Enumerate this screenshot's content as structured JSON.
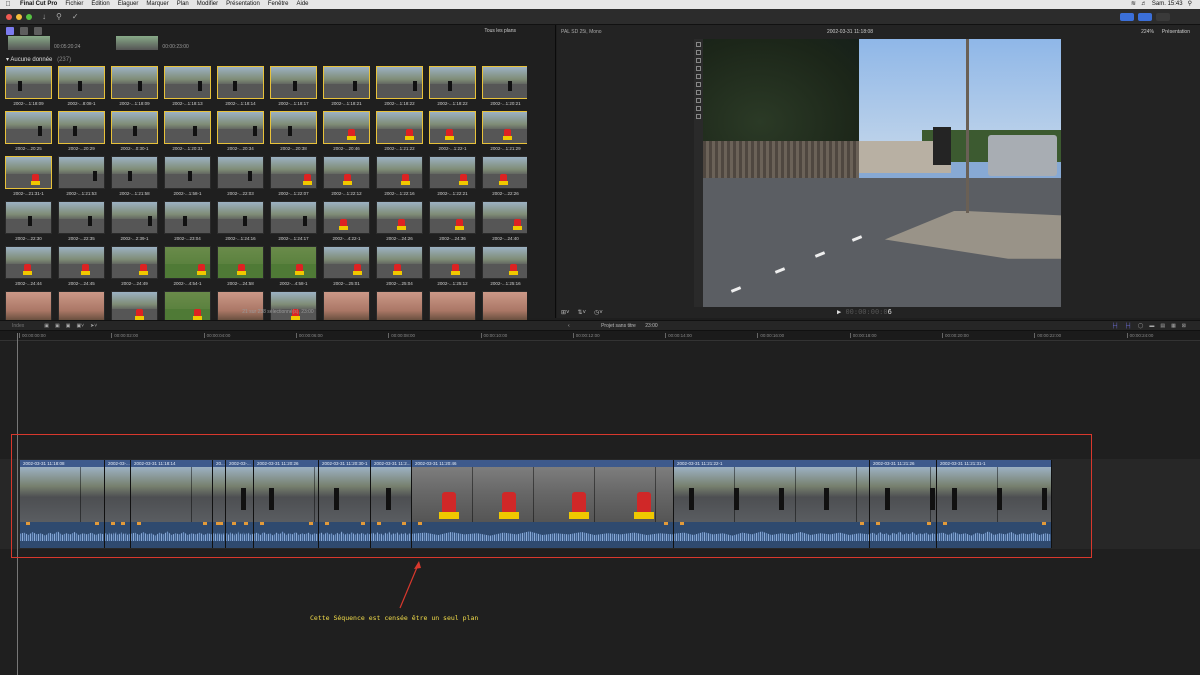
{
  "menubar": {
    "app": "Final Cut Pro",
    "items": [
      "Fichier",
      "Édition",
      "Élaguer",
      "Marquer",
      "Plan",
      "Modifier",
      "Présentation",
      "Fenêtre",
      "Aide"
    ],
    "clock": "Sam. 15:43"
  },
  "browser": {
    "filter": "Tous les plans",
    "top_clips": [
      {
        "time": "00:05:20:24"
      },
      {
        "time": "00:00:23:00"
      }
    ],
    "section": "Aucune donnée",
    "section_count": "(237)",
    "thumbs": [
      {
        "label": "2002-...1:18:09",
        "sel": true,
        "scene": "road"
      },
      {
        "label": "2002-...8:08-1",
        "sel": true,
        "scene": "road"
      },
      {
        "label": "2002-...1:18:09",
        "sel": true,
        "scene": "road"
      },
      {
        "label": "2002-...1:18:13",
        "sel": true,
        "scene": "road"
      },
      {
        "label": "2002-...1:18:14",
        "sel": true,
        "scene": "road"
      },
      {
        "label": "2002-...1:18:17",
        "sel": true,
        "scene": "road"
      },
      {
        "label": "2002-...1:18:21",
        "sel": true,
        "scene": "road"
      },
      {
        "label": "2002-...1:18:22",
        "sel": true,
        "scene": "road"
      },
      {
        "label": "2002-...1:18:22",
        "sel": true,
        "scene": "road"
      },
      {
        "label": "2002-...1:20:21",
        "sel": true,
        "scene": "road"
      },
      {
        "label": "2002-...20:25",
        "sel": true,
        "scene": "walk"
      },
      {
        "label": "2002-...20:29",
        "sel": true,
        "scene": "walk"
      },
      {
        "label": "2002-...0:30-1",
        "sel": true,
        "scene": "walk"
      },
      {
        "label": "2002-...1:20:31",
        "sel": true,
        "scene": "walk"
      },
      {
        "label": "2002-...20:34",
        "sel": true,
        "scene": "walk"
      },
      {
        "label": "2002-...20:38",
        "sel": true,
        "scene": "walk"
      },
      {
        "label": "2002-...20:46",
        "sel": true,
        "scene": "kid"
      },
      {
        "label": "2002-...1:21:22",
        "sel": true,
        "scene": "kid"
      },
      {
        "label": "2002-...1:22-1",
        "sel": true,
        "scene": "kid"
      },
      {
        "label": "2002-...1:21:29",
        "sel": true,
        "scene": "kid"
      },
      {
        "label": "2002-...21:31-1",
        "sel": true,
        "scene": "kid"
      },
      {
        "label": "2002-...1:21:53",
        "sel": false,
        "scene": "walk"
      },
      {
        "label": "2002-...1:21:58",
        "sel": false,
        "scene": "walk"
      },
      {
        "label": "2002-...1:58-1",
        "sel": false,
        "scene": "walk"
      },
      {
        "label": "2002-...22:03",
        "sel": false,
        "scene": "walk"
      },
      {
        "label": "2002-...1:22:07",
        "sel": false,
        "scene": "kid"
      },
      {
        "label": "2002-...1:22:12",
        "sel": false,
        "scene": "kid"
      },
      {
        "label": "2002-...1:22:16",
        "sel": false,
        "scene": "kid"
      },
      {
        "label": "2002-...1:22:21",
        "sel": false,
        "scene": "kid"
      },
      {
        "label": "2002-...22:26",
        "sel": false,
        "scene": "kid"
      },
      {
        "label": "2002-...22:30",
        "sel": false,
        "scene": "walk"
      },
      {
        "label": "2002-...22:35",
        "sel": false,
        "scene": "walk"
      },
      {
        "label": "2002-...2:39-1",
        "sel": false,
        "scene": "walk"
      },
      {
        "label": "2002-...23:04",
        "sel": false,
        "scene": "walk"
      },
      {
        "label": "2002-...1:24:16",
        "sel": false,
        "scene": "walk"
      },
      {
        "label": "2002-...1:24:17",
        "sel": false,
        "scene": "walk"
      },
      {
        "label": "2002-...4:22-1",
        "sel": false,
        "scene": "kid"
      },
      {
        "label": "2002-...24:26",
        "sel": false,
        "scene": "kid"
      },
      {
        "label": "2002-...24:36",
        "sel": false,
        "scene": "kid"
      },
      {
        "label": "2002-...24:40",
        "sel": false,
        "scene": "kid"
      },
      {
        "label": "2002-...24:44",
        "sel": false,
        "scene": "kid"
      },
      {
        "label": "2002-...24:45",
        "sel": false,
        "scene": "kid"
      },
      {
        "label": "2002-...24:49",
        "sel": false,
        "scene": "kid"
      },
      {
        "label": "2002-...4:54-1",
        "sel": false,
        "scene": "grass"
      },
      {
        "label": "2002-...24:58",
        "sel": false,
        "scene": "grass"
      },
      {
        "label": "2002-...4:58-1",
        "sel": false,
        "scene": "grass"
      },
      {
        "label": "2002-...25:01",
        "sel": false,
        "scene": "kid"
      },
      {
        "label": "2002-...25:04",
        "sel": false,
        "scene": "kid"
      },
      {
        "label": "2002-...1:25:12",
        "sel": false,
        "scene": "kid"
      },
      {
        "label": "2002-...1:25:16",
        "sel": false,
        "scene": "kid"
      },
      {
        "label": "",
        "sel": false,
        "scene": "close"
      },
      {
        "label": "",
        "sel": false,
        "scene": "close"
      },
      {
        "label": "",
        "sel": false,
        "scene": "kid"
      },
      {
        "label": "",
        "sel": false,
        "scene": "grass"
      },
      {
        "label": "",
        "sel": false,
        "scene": "close"
      },
      {
        "label": "",
        "sel": false,
        "scene": "kid"
      },
      {
        "label": "",
        "sel": false,
        "scene": "close"
      },
      {
        "label": "",
        "sel": false,
        "scene": "close"
      },
      {
        "label": "",
        "sel": false,
        "scene": "close"
      },
      {
        "label": "",
        "sel": false,
        "scene": "close"
      }
    ],
    "status": "21 sur 238 sélectionné(s), 23:00"
  },
  "viewer": {
    "format": "PAL SD 25i, Mono",
    "title": "2002-03-31 11:18:08",
    "zoom": "224%",
    "presentation": "Présentation",
    "timecode_dim": "00:00:00:0",
    "timecode_val": "6"
  },
  "timeline": {
    "index": "Index",
    "project": "Projet sans titre",
    "duration": "23:00",
    "ruler": [
      "00:00:00:00",
      "00:00:02:00",
      "00:00:04:00",
      "00:00:06:00",
      "00:00:08:00",
      "00:00:10:00",
      "00:00:12:00",
      "00:00:14:00",
      "00:00:16:00",
      "00:00:18:00",
      "00:00:20:00",
      "00:00:22:00",
      "00:00:24:00"
    ],
    "clips": [
      {
        "title": "2002-03-31 11:18:08",
        "scene": "road"
      },
      {
        "title": "2002-03-...",
        "scene": "road"
      },
      {
        "title": "2002-03-31 11:18:14",
        "scene": "road"
      },
      {
        "title": "20...",
        "scene": "road"
      },
      {
        "title": "2002-03-...",
        "scene": "walk"
      },
      {
        "title": "2002-03-31 11:20:26",
        "scene": "walk"
      },
      {
        "title": "2002-03-31 11:20:30-1",
        "scene": "walk"
      },
      {
        "title": "2002-03-31 11:2...",
        "scene": "walk"
      },
      {
        "title": "2002-03-31 11:20:46",
        "scene": "kids"
      },
      {
        "title": "2002-03-31 11:21:22-1",
        "scene": "walk"
      },
      {
        "title": "2002-03-31 11:21:26",
        "scene": "walk"
      },
      {
        "title": "2002-03-31 11:21:31-1",
        "scene": "walk"
      }
    ]
  },
  "annotation": "Cette Séquence est censée être un seul plan",
  "colors": {
    "selection": "#e8c23a",
    "highlight": "#d8382d",
    "annotation": "#f2dc4a",
    "clip_header": "#3e5a8c",
    "audio": "#2f4a6f"
  }
}
